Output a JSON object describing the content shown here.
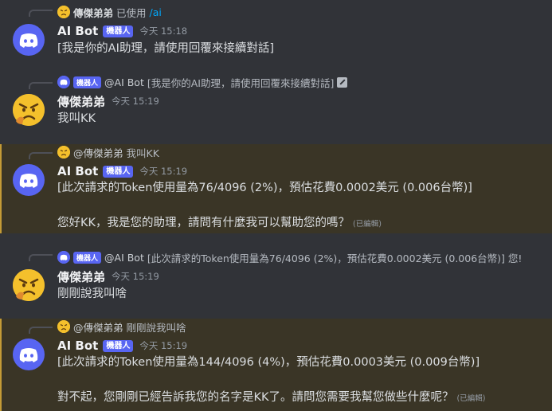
{
  "messages": [
    {
      "reply": {
        "user": "傳傑弟弟",
        "action": "已使用",
        "command": "/ai"
      },
      "author": "AI Bot",
      "badge": "機器人",
      "time": "今天 15:18",
      "lines": [
        "[我是你的AI助理，請使用回覆來接續對話]"
      ]
    },
    {
      "reply": {
        "badge": "機器人",
        "user": "@AI Bot",
        "text": "[我是你的AI助理，請使用回覆來接續對話]"
      },
      "author": "傳傑弟弟",
      "time": "今天 15:19",
      "lines": [
        "我叫KK"
      ]
    },
    {
      "reply": {
        "user": "@傳傑弟弟",
        "text": "我叫KK"
      },
      "author": "AI Bot",
      "badge": "機器人",
      "time": "今天 15:19",
      "lines": [
        "[此次請求的Token使用量為76/4096 (2%)，預估花費0.0002美元 (0.006台幣)]",
        "您好KK，我是您的助理，請問有什麼我可以幫助您的嗎？"
      ],
      "edited": "(已編輯)"
    },
    {
      "reply": {
        "badge": "機器人",
        "user": "@AI Bot",
        "text": "[此次請求的Token使用量為76/4096 (2%)，預估花費0.0002美元 (0.006台幣)] 您!"
      },
      "author": "傳傑弟弟",
      "time": "今天 15:19",
      "lines": [
        "剛剛說我叫啥"
      ]
    },
    {
      "reply": {
        "user": "@傳傑弟弟",
        "text": "剛剛說我叫啥"
      },
      "author": "AI Bot",
      "badge": "機器人",
      "time": "今天 15:19",
      "lines": [
        "[此次請求的Token使用量為144/4096 (4%)，預估花費0.0003美元 (0.009台幣)]",
        "對不起，您剛剛已經告訴我您的名字是KK了。請問您需要我幫您做些什麼呢？"
      ],
      "edited": "(已編輯)"
    }
  ],
  "colors": {
    "background": "#313338",
    "highlight": "#3a3526",
    "highlight_border": "#c49b36",
    "blurple": "#5865f2",
    "link": "#00a8fc"
  },
  "icons": {
    "bot_avatar": "discord-logo-icon",
    "user_avatar": "angry-face-emoji-icon",
    "edit": "edit-icon"
  }
}
